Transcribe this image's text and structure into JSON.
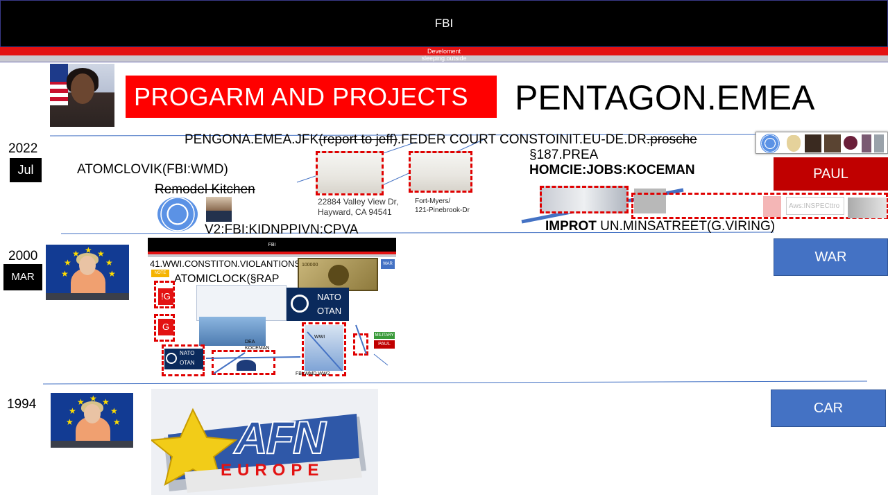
{
  "header": {
    "title": "FBI",
    "subtitle1": "Develoment",
    "subtitle2": "sleeping outside"
  },
  "titles": {
    "program": "PROGARM AND PROJECTS",
    "pentagon": "PENTAGON.EMEA"
  },
  "timeline": [
    {
      "year": "2022",
      "month": "Jul"
    },
    {
      "year": "2000",
      "month": "MAR"
    },
    {
      "year": "1994"
    }
  ],
  "buttons": {
    "paul": "PAUL",
    "war": "WAR",
    "car": "CAR"
  },
  "labels": {
    "pengona_main": "PENGONA.EMEA.JFK",
    "pengona_strike1": "(report to jeff)",
    "pengona_mid": ".FEDER COURT CONSTOINIT.EU-DE.DR",
    "pengona_strike2": ".prosche",
    "atomclovik": "ATOMCLOVIK(FBI:WMD)",
    "remodel": "Remodel Kitchen",
    "v2": "V2:FBI:KIDNPPIVN:CPVA",
    "address1_line1": "22884 Valley View Dr,",
    "address1_line2": "Hayward, CA 94541",
    "address2_line1": "Fort-Myers/",
    "address2_line2": "121-Pinebrook-Dr",
    "prea": "§187.PREA",
    "homcie": "HOMCIE:JOBS:KOCEMAN",
    "improt_bold": "IMPROT",
    "improt_rest": " UN.MINSATREET(G.VIRING)",
    "aws": "Aws:INSPECttro"
  },
  "mini_slide": {
    "title": "FBI",
    "wwi": "41.WWI.CONSTITON.VIOLANTIONS",
    "atomiclock": "ATOMICLOCK(§RAP",
    "note": "NOTE",
    "war_tag": "WAR",
    "ig": "!G",
    "g": "G",
    "nato": "NATO",
    "otan": "OTAN",
    "dea": "DEA",
    "koceman": "KOCEMAN",
    "wwi_small": "WWI",
    "military": "MILITARY",
    "paul": "PAUL",
    "fbi_wmd": "FBI:WMD.WW2",
    "money": "100000"
  },
  "afn": {
    "letters": "AFN",
    "europe": "EUROPE"
  },
  "colors": {
    "red": "#ff0000",
    "blue_button": "#4472c4",
    "dark_red": "#c00000"
  }
}
